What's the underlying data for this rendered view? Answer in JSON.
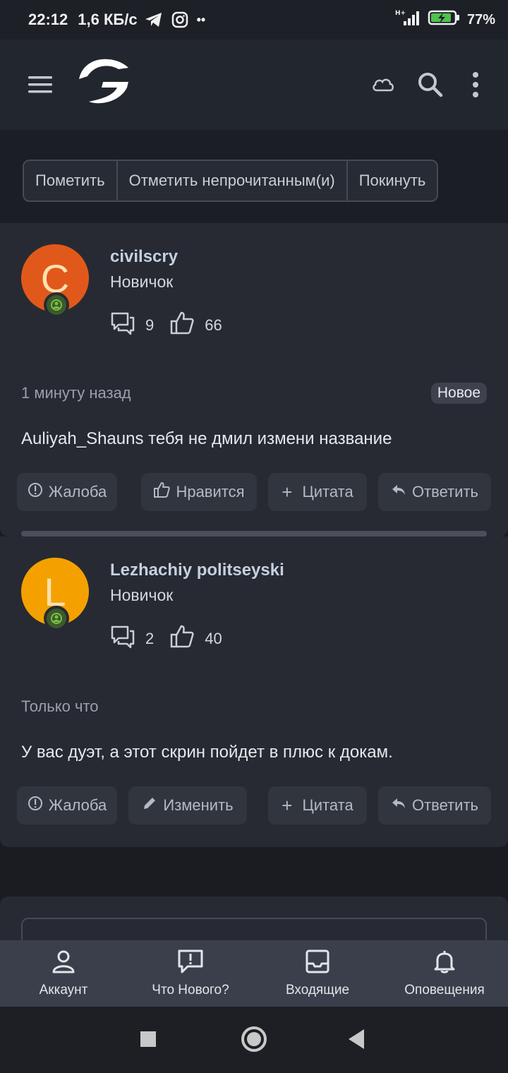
{
  "status_bar": {
    "time": "22:12",
    "speed": "1,6 КБ/с",
    "battery": "77%",
    "network": "H+",
    "dots": "••"
  },
  "header": {
    "icons": [
      "menu-icon",
      "app-logo",
      "cloud-icon",
      "search-icon",
      "more-vertical-icon"
    ]
  },
  "thread_actions": {
    "mark": "Пометить",
    "mark_unread": "Отметить непрочитанным(и)",
    "leave": "Покинуть"
  },
  "posts": [
    {
      "avatar_letter": "C",
      "avatar_color": "#e0591a",
      "username": "civilscry",
      "rank": "Новичок",
      "messages": "9",
      "likes": "66",
      "time": "1 минуту назад",
      "badge": "Новое",
      "text": "Auliyah_Shauns тебя не дмил измени название",
      "actions": {
        "report": "Жалоба",
        "like": "Нравится",
        "quote": "Цитата",
        "reply": "Ответить"
      }
    },
    {
      "avatar_letter": "L",
      "avatar_color": "#f4a100",
      "username": "Lezhachiy politseyski",
      "rank": "Новичок",
      "messages": "2",
      "likes": "40",
      "time": "Только что",
      "text": "У вас дуэт, а этот скрин пойдет в плюс к докам.",
      "actions": {
        "report": "Жалоба",
        "edit": "Изменить",
        "quote": "Цитата",
        "reply": "Ответить"
      }
    }
  ],
  "bottom_nav": {
    "account": "Аккаунт",
    "whats_new": "Что Нового?",
    "inbox": "Входящие",
    "alerts": "Оповещения"
  },
  "colors": {
    "accent_online": "#7bc043",
    "background": "#1a1c21",
    "card": "#272a32"
  }
}
